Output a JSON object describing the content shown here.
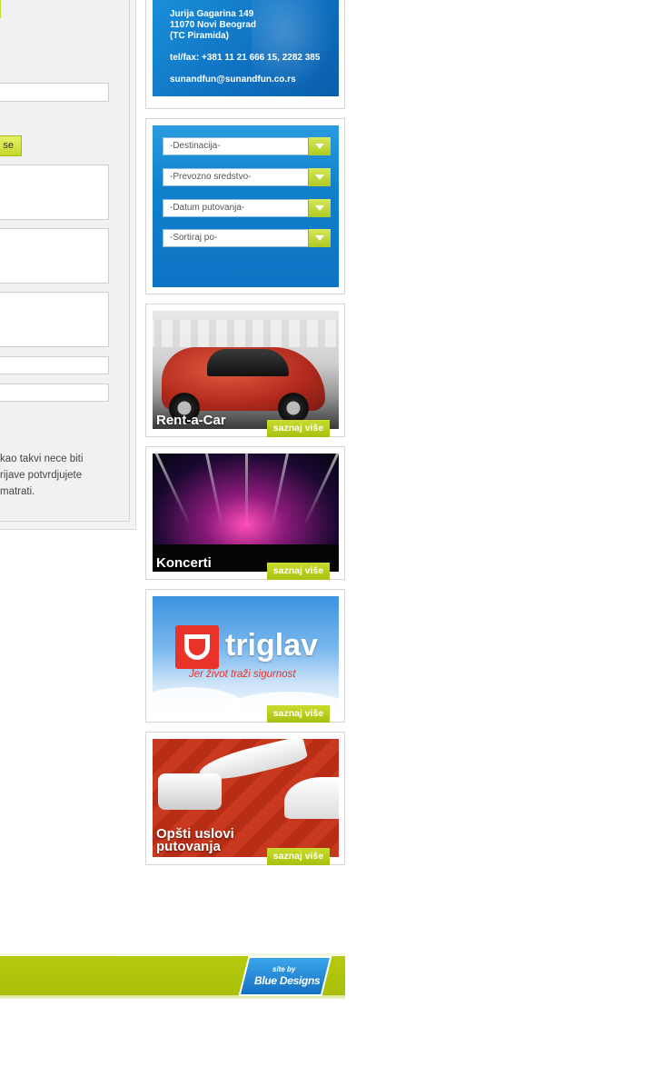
{
  "form": {
    "submit_label": "se",
    "note_lines": [
      "kao takvi nece biti",
      "rijave potvrdjujete",
      "matrati."
    ]
  },
  "contact": {
    "address_line1": "Jurija Gagarina 149",
    "address_line2": "11070 Novi Beograd",
    "address_line3": "(TC Piramida)",
    "phone": "tel/fax: +381 11 21 666 15,  2282 385",
    "email": "sunandfun@sunandfun.co.rs"
  },
  "search": {
    "destination": "-Destinacija-",
    "transport": "-Prevozno sredstvo-",
    "date": "-Datum putovanja-",
    "sort": "-Sortiraj po-"
  },
  "promos": [
    {
      "title": "Rent-a-Car",
      "more": "saznaj više"
    },
    {
      "title": "Koncerti",
      "more": "saznaj više"
    },
    {
      "title": "triglav",
      "slogan": "Jer život traži sigurnost",
      "more": "saznaj više"
    },
    {
      "title_line1": "Opšti uslovi",
      "title_line2": "putovanja",
      "more": "saznaj više"
    }
  ],
  "footer": {
    "site_by": "site by",
    "designer": "Blue Designs"
  },
  "colors": {
    "accent_green": "#b5ca0d",
    "brand_blue": "#1680d0",
    "triglav_red": "#e8322a"
  }
}
